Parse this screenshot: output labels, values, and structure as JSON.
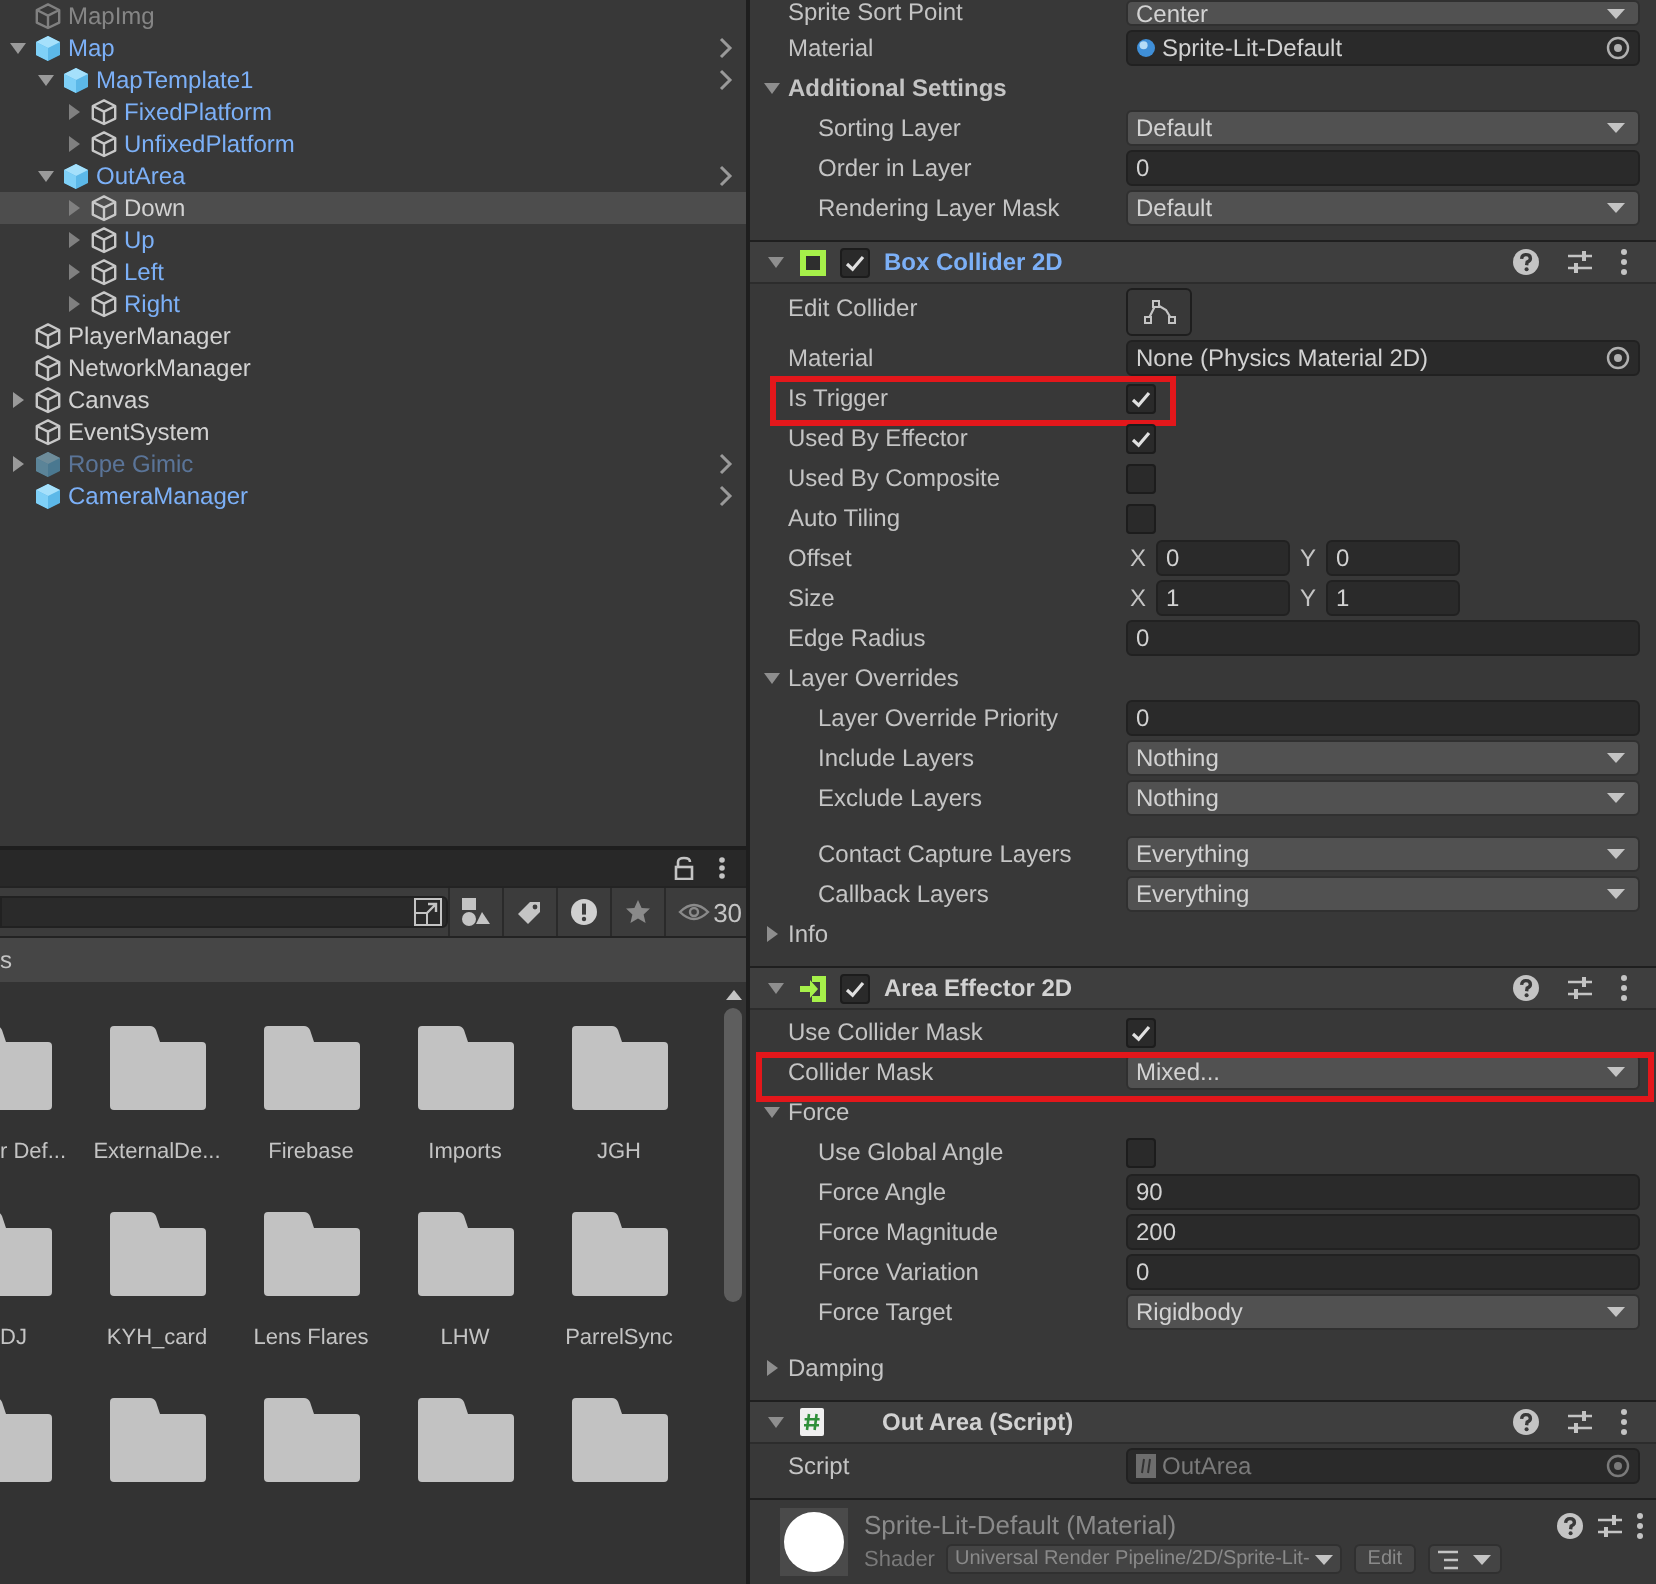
{
  "hierarchy": {
    "items": [
      {
        "name": "MapImg",
        "kind": "object",
        "has_children": false,
        "expanded": false,
        "inactive": true,
        "selected": false
      },
      {
        "name": "Map",
        "kind": "prefab_root",
        "has_children": true,
        "expanded": true,
        "inactive": false,
        "selected": false,
        "children": [
          {
            "name": "MapTemplate1",
            "kind": "prefab_root",
            "has_children": true,
            "expanded": true,
            "inactive": false,
            "selected": false,
            "children": [
              {
                "name": "FixedPlatform",
                "kind": "prefab_part",
                "has_children": true,
                "expanded": false,
                "inactive": false,
                "selected": false
              },
              {
                "name": "UnfixedPlatform",
                "kind": "prefab_part",
                "has_children": true,
                "expanded": false,
                "inactive": false,
                "selected": false
              }
            ]
          },
          {
            "name": "OutArea",
            "kind": "prefab_root",
            "has_children": true,
            "expanded": true,
            "inactive": false,
            "selected": false,
            "children": [
              {
                "name": "Down",
                "kind": "object",
                "has_children": true,
                "expanded": false,
                "inactive": false,
                "selected": true
              },
              {
                "name": "Up",
                "kind": "prefab_part",
                "has_children": true,
                "expanded": false,
                "inactive": false,
                "selected": false
              },
              {
                "name": "Left",
                "kind": "prefab_part",
                "has_children": true,
                "expanded": false,
                "inactive": false,
                "selected": false
              },
              {
                "name": "Right",
                "kind": "prefab_part",
                "has_children": true,
                "expanded": false,
                "inactive": false,
                "selected": false
              }
            ]
          }
        ]
      },
      {
        "name": "PlayerManager",
        "kind": "object",
        "has_children": false,
        "expanded": false,
        "inactive": false,
        "selected": false
      },
      {
        "name": "NetworkManager",
        "kind": "object",
        "has_children": false,
        "expanded": false,
        "inactive": false,
        "selected": false
      },
      {
        "name": "Canvas",
        "kind": "object",
        "has_children": true,
        "expanded": false,
        "inactive": false,
        "selected": false
      },
      {
        "name": "EventSystem",
        "kind": "object",
        "has_children": false,
        "expanded": false,
        "inactive": false,
        "selected": false
      },
      {
        "name": "Rope Gimic",
        "kind": "prefab_root",
        "has_children": true,
        "expanded": false,
        "inactive": true,
        "selected": false
      },
      {
        "name": "CameraManager",
        "kind": "prefab_root",
        "has_children": false,
        "expanded": false,
        "inactive": false,
        "selected": false
      }
    ]
  },
  "project": {
    "count": "30",
    "breadcrumb": "s",
    "folders": [
      {
        "name": "r Def...",
        "partial": true
      },
      {
        "name": "ExternalDe...",
        "partial": false
      },
      {
        "name": "Firebase",
        "partial": false
      },
      {
        "name": "Imports",
        "partial": false
      },
      {
        "name": "JGH",
        "partial": false
      },
      {
        "name": "DJ",
        "partial": true
      },
      {
        "name": "KYH_card",
        "partial": false
      },
      {
        "name": "Lens Flares",
        "partial": false
      },
      {
        "name": "LHW",
        "partial": false
      },
      {
        "name": "ParrelSync",
        "partial": false
      },
      {
        "partial": true
      },
      {
        "partial": false
      },
      {
        "partial": false
      },
      {
        "partial": false
      },
      {
        "partial": false
      }
    ]
  },
  "inspector": {
    "items": [
      {
        "kind": "dropdown",
        "label": "Sprite Sort Point",
        "value": "Center"
      },
      {
        "kind": "material_ref",
        "label": "Material",
        "value": "Sprite-Lit-Default",
        "disabled": false
      },
      {
        "kind": "foldout",
        "label": "Additional Settings",
        "bold": true,
        "expanded": true,
        "children": [
          {
            "kind": "dropdown",
            "label": "Sorting Layer",
            "value": "Default"
          },
          {
            "kind": "number",
            "label": "Order in Layer",
            "value": "0"
          },
          {
            "kind": "dropdown",
            "label": "Rendering Layer Mask",
            "value": "Default"
          }
        ]
      },
      {
        "kind": "collider",
        "title": "Box Collider 2D",
        "enabled": true,
        "overridden": true,
        "expanded": true,
        "children": [
          {
            "kind": "edit_button",
            "label": "Edit Collider"
          },
          {
            "kind": "object",
            "label": "Material",
            "value": "None (Physics Material 2D)",
            "disabled": false
          },
          {
            "kind": "checkbox",
            "label": "Is Trigger",
            "checked": true,
            "highlighted": true
          },
          {
            "kind": "checkbox",
            "label": "Used By Effector",
            "checked": true
          },
          {
            "kind": "checkbox",
            "label": "Used By Composite",
            "checked": false
          },
          {
            "kind": "checkbox",
            "label": "Auto Tiling",
            "checked": false
          },
          {
            "kind": "vector",
            "label": "Offset",
            "fields": [
              {
                "axis": "X",
                "value": "0"
              },
              {
                "axis": "Y",
                "value": "0"
              }
            ]
          },
          {
            "kind": "vector",
            "label": "Size",
            "fields": [
              {
                "axis": "X",
                "value": "1"
              },
              {
                "axis": "Y",
                "value": "1"
              }
            ]
          },
          {
            "kind": "number",
            "label": "Edge Radius",
            "value": "0"
          },
          {
            "kind": "foldout",
            "label": "Layer Overrides",
            "bold": false,
            "expanded": true,
            "children": [
              {
                "kind": "number",
                "label": "Layer Override Priority",
                "value": "0"
              },
              {
                "kind": "dropdown",
                "label": "Include Layers",
                "value": "Nothing"
              },
              {
                "kind": "dropdown",
                "label": "Exclude Layers",
                "value": "Nothing"
              },
              {
                "kind": "dropdown",
                "label": "Contact Capture Layers",
                "value": "Everything",
                "spaced": true
              },
              {
                "kind": "dropdown",
                "label": "Callback Layers",
                "value": "Everything"
              }
            ]
          },
          {
            "kind": "foldout",
            "label": "Info",
            "bold": false,
            "expanded": false
          }
        ]
      },
      {
        "kind": "effector",
        "title": "Area Effector 2D",
        "enabled": true,
        "overridden": false,
        "expanded": true,
        "children": [
          {
            "kind": "checkbox",
            "label": "Use Collider Mask",
            "checked": true
          },
          {
            "kind": "dropdown",
            "label": "Collider Mask",
            "value": "Mixed...",
            "highlighted": true
          },
          {
            "kind": "foldout",
            "label": "Force",
            "bold": false,
            "expanded": true,
            "children": [
              {
                "kind": "checkbox",
                "label": "Use Global Angle",
                "checked": false
              },
              {
                "kind": "number",
                "label": "Force Angle",
                "value": "90"
              },
              {
                "kind": "number",
                "label": "Force Magnitude",
                "value": "200"
              },
              {
                "kind": "number",
                "label": "Force Variation",
                "value": "0"
              },
              {
                "kind": "dropdown",
                "label": "Force Target",
                "value": "Rigidbody"
              }
            ]
          },
          {
            "kind": "foldout",
            "label": "Damping",
            "bold": false,
            "expanded": false,
            "spaced": true
          }
        ]
      },
      {
        "kind": "script",
        "title": "Out Area (Script)",
        "overridden": false,
        "expanded": true,
        "children": [
          {
            "kind": "script_ref",
            "label": "Script",
            "value": "OutArea",
            "disabled": true
          }
        ]
      },
      {
        "kind": "material",
        "title": "Sprite-Lit-Default (Material)",
        "shader_label": "Shader",
        "shader": "Universal Render Pipeline/2D/Sprite-Lit-",
        "edit": "Edit"
      }
    ]
  }
}
